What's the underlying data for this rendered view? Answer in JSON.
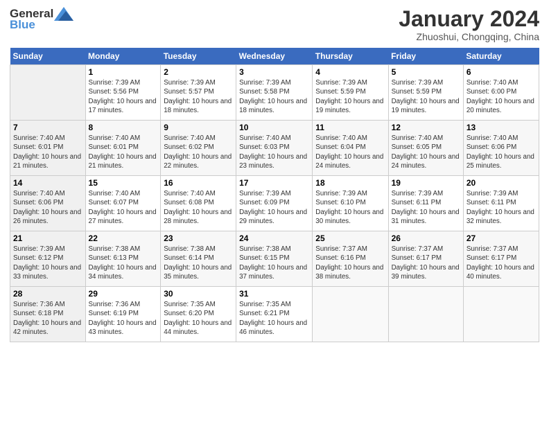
{
  "header": {
    "logo_general": "General",
    "logo_blue": "Blue",
    "title": "January 2024",
    "subtitle": "Zhuoshui, Chongqing, China"
  },
  "calendar": {
    "days_of_week": [
      "Sunday",
      "Monday",
      "Tuesday",
      "Wednesday",
      "Thursday",
      "Friday",
      "Saturday"
    ],
    "weeks": [
      [
        {
          "day": "",
          "sunrise": "",
          "sunset": "",
          "daylight": "",
          "empty": true
        },
        {
          "day": "1",
          "sunrise": "Sunrise: 7:39 AM",
          "sunset": "Sunset: 5:56 PM",
          "daylight": "Daylight: 10 hours and 17 minutes."
        },
        {
          "day": "2",
          "sunrise": "Sunrise: 7:39 AM",
          "sunset": "Sunset: 5:57 PM",
          "daylight": "Daylight: 10 hours and 18 minutes."
        },
        {
          "day": "3",
          "sunrise": "Sunrise: 7:39 AM",
          "sunset": "Sunset: 5:58 PM",
          "daylight": "Daylight: 10 hours and 18 minutes."
        },
        {
          "day": "4",
          "sunrise": "Sunrise: 7:39 AM",
          "sunset": "Sunset: 5:59 PM",
          "daylight": "Daylight: 10 hours and 19 minutes."
        },
        {
          "day": "5",
          "sunrise": "Sunrise: 7:39 AM",
          "sunset": "Sunset: 5:59 PM",
          "daylight": "Daylight: 10 hours and 19 minutes."
        },
        {
          "day": "6",
          "sunrise": "Sunrise: 7:40 AM",
          "sunset": "Sunset: 6:00 PM",
          "daylight": "Daylight: 10 hours and 20 minutes."
        }
      ],
      [
        {
          "day": "7",
          "sunrise": "Sunrise: 7:40 AM",
          "sunset": "Sunset: 6:01 PM",
          "daylight": "Daylight: 10 hours and 21 minutes."
        },
        {
          "day": "8",
          "sunrise": "Sunrise: 7:40 AM",
          "sunset": "Sunset: 6:01 PM",
          "daylight": "Daylight: 10 hours and 21 minutes."
        },
        {
          "day": "9",
          "sunrise": "Sunrise: 7:40 AM",
          "sunset": "Sunset: 6:02 PM",
          "daylight": "Daylight: 10 hours and 22 minutes."
        },
        {
          "day": "10",
          "sunrise": "Sunrise: 7:40 AM",
          "sunset": "Sunset: 6:03 PM",
          "daylight": "Daylight: 10 hours and 23 minutes."
        },
        {
          "day": "11",
          "sunrise": "Sunrise: 7:40 AM",
          "sunset": "Sunset: 6:04 PM",
          "daylight": "Daylight: 10 hours and 24 minutes."
        },
        {
          "day": "12",
          "sunrise": "Sunrise: 7:40 AM",
          "sunset": "Sunset: 6:05 PM",
          "daylight": "Daylight: 10 hours and 24 minutes."
        },
        {
          "day": "13",
          "sunrise": "Sunrise: 7:40 AM",
          "sunset": "Sunset: 6:06 PM",
          "daylight": "Daylight: 10 hours and 25 minutes."
        }
      ],
      [
        {
          "day": "14",
          "sunrise": "Sunrise: 7:40 AM",
          "sunset": "Sunset: 6:06 PM",
          "daylight": "Daylight: 10 hours and 26 minutes."
        },
        {
          "day": "15",
          "sunrise": "Sunrise: 7:40 AM",
          "sunset": "Sunset: 6:07 PM",
          "daylight": "Daylight: 10 hours and 27 minutes."
        },
        {
          "day": "16",
          "sunrise": "Sunrise: 7:40 AM",
          "sunset": "Sunset: 6:08 PM",
          "daylight": "Daylight: 10 hours and 28 minutes."
        },
        {
          "day": "17",
          "sunrise": "Sunrise: 7:39 AM",
          "sunset": "Sunset: 6:09 PM",
          "daylight": "Daylight: 10 hours and 29 minutes."
        },
        {
          "day": "18",
          "sunrise": "Sunrise: 7:39 AM",
          "sunset": "Sunset: 6:10 PM",
          "daylight": "Daylight: 10 hours and 30 minutes."
        },
        {
          "day": "19",
          "sunrise": "Sunrise: 7:39 AM",
          "sunset": "Sunset: 6:11 PM",
          "daylight": "Daylight: 10 hours and 31 minutes."
        },
        {
          "day": "20",
          "sunrise": "Sunrise: 7:39 AM",
          "sunset": "Sunset: 6:11 PM",
          "daylight": "Daylight: 10 hours and 32 minutes."
        }
      ],
      [
        {
          "day": "21",
          "sunrise": "Sunrise: 7:39 AM",
          "sunset": "Sunset: 6:12 PM",
          "daylight": "Daylight: 10 hours and 33 minutes."
        },
        {
          "day": "22",
          "sunrise": "Sunrise: 7:38 AM",
          "sunset": "Sunset: 6:13 PM",
          "daylight": "Daylight: 10 hours and 34 minutes."
        },
        {
          "day": "23",
          "sunrise": "Sunrise: 7:38 AM",
          "sunset": "Sunset: 6:14 PM",
          "daylight": "Daylight: 10 hours and 35 minutes."
        },
        {
          "day": "24",
          "sunrise": "Sunrise: 7:38 AM",
          "sunset": "Sunset: 6:15 PM",
          "daylight": "Daylight: 10 hours and 37 minutes."
        },
        {
          "day": "25",
          "sunrise": "Sunrise: 7:37 AM",
          "sunset": "Sunset: 6:16 PM",
          "daylight": "Daylight: 10 hours and 38 minutes."
        },
        {
          "day": "26",
          "sunrise": "Sunrise: 7:37 AM",
          "sunset": "Sunset: 6:17 PM",
          "daylight": "Daylight: 10 hours and 39 minutes."
        },
        {
          "day": "27",
          "sunrise": "Sunrise: 7:37 AM",
          "sunset": "Sunset: 6:17 PM",
          "daylight": "Daylight: 10 hours and 40 minutes."
        }
      ],
      [
        {
          "day": "28",
          "sunrise": "Sunrise: 7:36 AM",
          "sunset": "Sunset: 6:18 PM",
          "daylight": "Daylight: 10 hours and 42 minutes."
        },
        {
          "day": "29",
          "sunrise": "Sunrise: 7:36 AM",
          "sunset": "Sunset: 6:19 PM",
          "daylight": "Daylight: 10 hours and 43 minutes."
        },
        {
          "day": "30",
          "sunrise": "Sunrise: 7:35 AM",
          "sunset": "Sunset: 6:20 PM",
          "daylight": "Daylight: 10 hours and 44 minutes."
        },
        {
          "day": "31",
          "sunrise": "Sunrise: 7:35 AM",
          "sunset": "Sunset: 6:21 PM",
          "daylight": "Daylight: 10 hours and 46 minutes."
        },
        {
          "day": "",
          "sunrise": "",
          "sunset": "",
          "daylight": "",
          "empty": true
        },
        {
          "day": "",
          "sunrise": "",
          "sunset": "",
          "daylight": "",
          "empty": true
        },
        {
          "day": "",
          "sunrise": "",
          "sunset": "",
          "daylight": "",
          "empty": true
        }
      ]
    ]
  }
}
